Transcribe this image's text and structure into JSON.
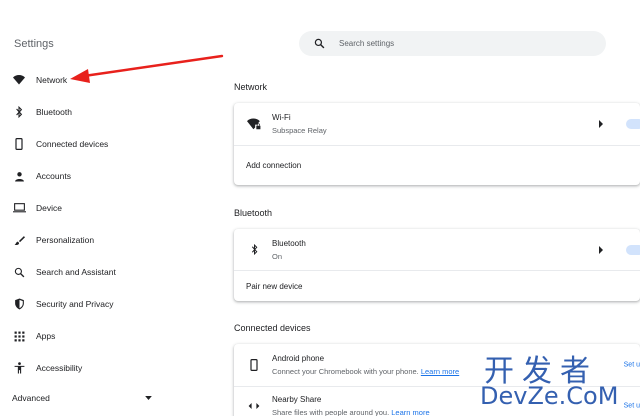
{
  "app": {
    "title": "Settings"
  },
  "search": {
    "placeholder": "Search settings"
  },
  "sidebar": {
    "items": [
      {
        "label": "Network",
        "icon": "wifi-icon"
      },
      {
        "label": "Bluetooth",
        "icon": "bluetooth-icon"
      },
      {
        "label": "Connected devices",
        "icon": "phone-icon"
      },
      {
        "label": "Accounts",
        "icon": "person-icon"
      },
      {
        "label": "Device",
        "icon": "laptop-icon"
      },
      {
        "label": "Personalization",
        "icon": "brush-icon"
      },
      {
        "label": "Search and Assistant",
        "icon": "search-icon"
      },
      {
        "label": "Security and Privacy",
        "icon": "shield-icon"
      },
      {
        "label": "Apps",
        "icon": "apps-grid-icon"
      },
      {
        "label": "Accessibility",
        "icon": "accessibility-icon"
      }
    ],
    "advanced_label": "Advanced"
  },
  "annotation": {
    "arrow_color": "#e8211c"
  },
  "main": {
    "network": {
      "title": "Network",
      "wifi": {
        "name": "Wi-Fi",
        "status": "Subspace Relay"
      },
      "add_connection": "Add connection"
    },
    "bluetooth": {
      "title": "Bluetooth",
      "row": {
        "name": "Bluetooth",
        "status": "On"
      },
      "pair": "Pair new device"
    },
    "connected_devices": {
      "title": "Connected devices",
      "android": {
        "name": "Android phone",
        "desc": "Connect your Chromebook with your phone.",
        "link": "Learn more",
        "action": "Set u"
      },
      "nearby": {
        "name": "Nearby Share",
        "desc": "Share files with people around you.",
        "link": "Learn more",
        "action": "Set u"
      }
    }
  },
  "watermark": {
    "line1": "开发者",
    "line2": "DevZe.CoM"
  },
  "colors": {
    "accent": "#1a73e8",
    "text": "#202124",
    "secondary": "#5f6368"
  }
}
